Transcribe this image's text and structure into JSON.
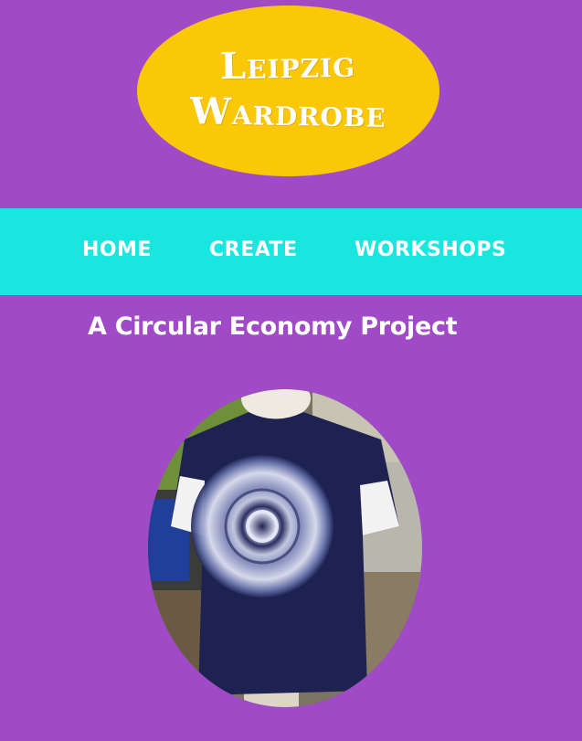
{
  "logo": {
    "line1": "Leipzig",
    "line2": "Wardrobe",
    "background_color": "#fbc808"
  },
  "nav": {
    "background_color": "#18e6df",
    "items": [
      {
        "label": "HOME"
      },
      {
        "label": "CREATE"
      },
      {
        "label": "WORKSHOPS"
      }
    ]
  },
  "main": {
    "title": "A Circular Economy Project",
    "photo_subject": "navy tie-dye t-shirt on a mannequin"
  },
  "colors": {
    "page_background": "#a04ac8",
    "text": "#ffffff"
  }
}
